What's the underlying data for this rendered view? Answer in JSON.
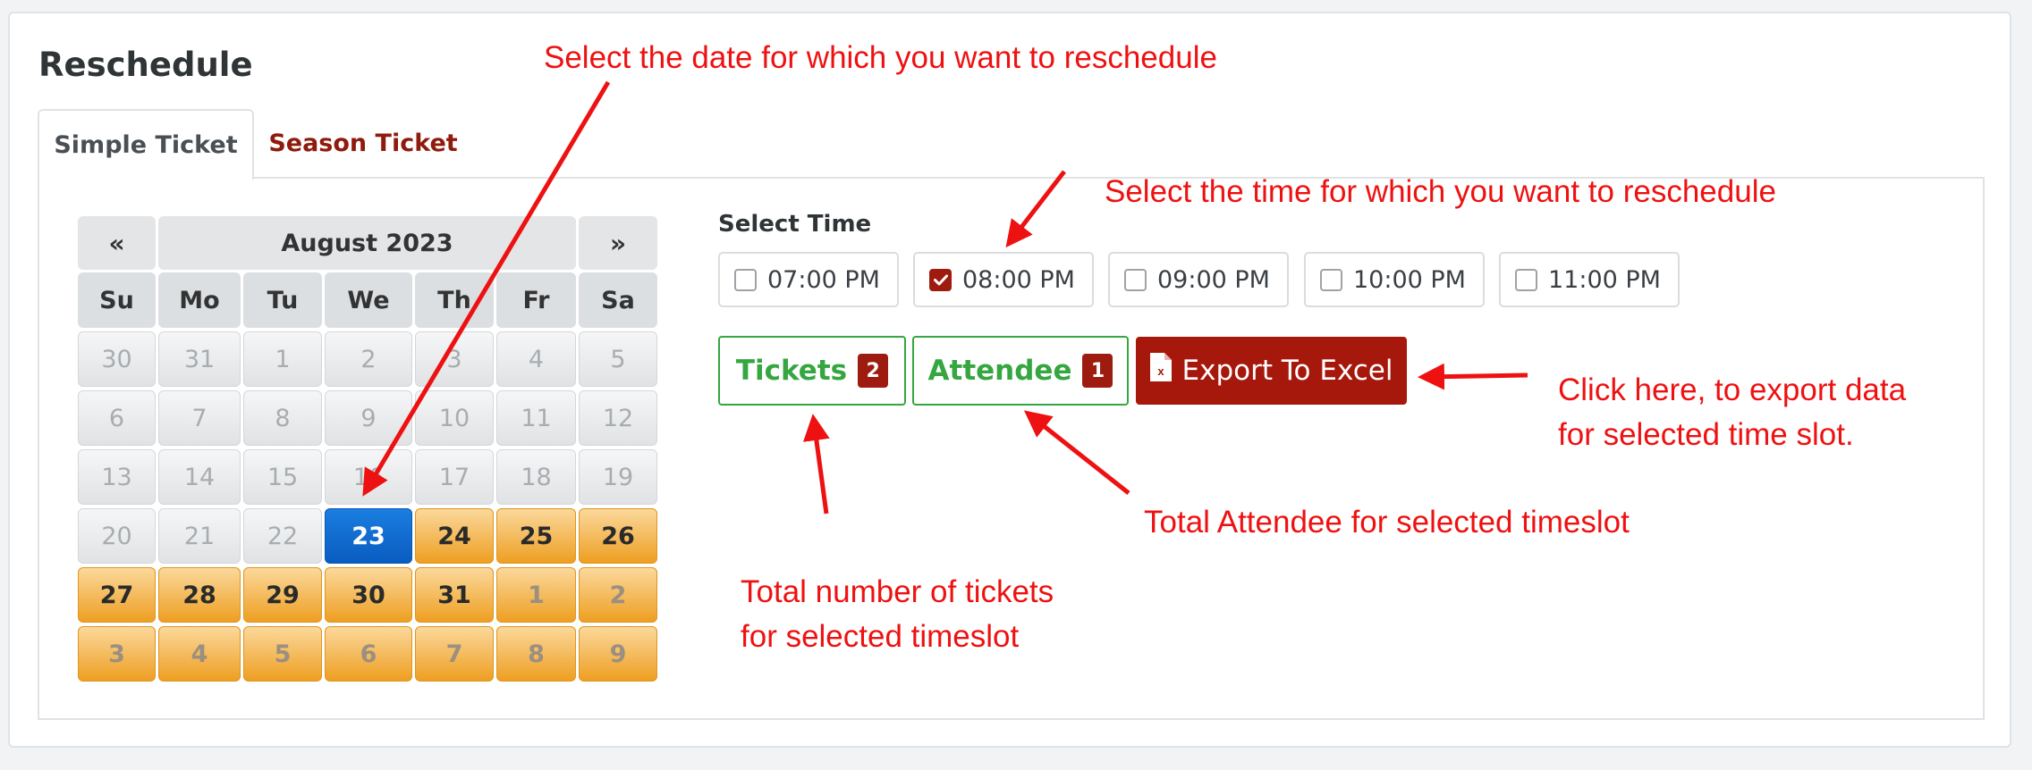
{
  "page": {
    "title": "Reschedule"
  },
  "tabs": [
    {
      "label": "Simple Ticket",
      "active": true
    },
    {
      "label": "Season Ticket",
      "active": false
    }
  ],
  "calendar": {
    "prev_label": "«",
    "next_label": "»",
    "month_label": "August 2023",
    "weekdays": [
      "Su",
      "Mo",
      "Tu",
      "We",
      "Th",
      "Fr",
      "Sa"
    ],
    "weeks": [
      [
        {
          "d": "30",
          "s": "dis"
        },
        {
          "d": "31",
          "s": "dis"
        },
        {
          "d": "1",
          "s": "dis"
        },
        {
          "d": "2",
          "s": "dis"
        },
        {
          "d": "3",
          "s": "dis"
        },
        {
          "d": "4",
          "s": "dis"
        },
        {
          "d": "5",
          "s": "dis"
        }
      ],
      [
        {
          "d": "6",
          "s": "dis"
        },
        {
          "d": "7",
          "s": "dis"
        },
        {
          "d": "8",
          "s": "dis"
        },
        {
          "d": "9",
          "s": "dis"
        },
        {
          "d": "10",
          "s": "dis"
        },
        {
          "d": "11",
          "s": "dis"
        },
        {
          "d": "12",
          "s": "dis"
        }
      ],
      [
        {
          "d": "13",
          "s": "dis"
        },
        {
          "d": "14",
          "s": "dis"
        },
        {
          "d": "15",
          "s": "dis"
        },
        {
          "d": "16",
          "s": "dis"
        },
        {
          "d": "17",
          "s": "dis"
        },
        {
          "d": "18",
          "s": "dis"
        },
        {
          "d": "19",
          "s": "dis"
        }
      ],
      [
        {
          "d": "20",
          "s": "dis"
        },
        {
          "d": "21",
          "s": "dis"
        },
        {
          "d": "22",
          "s": "dis"
        },
        {
          "d": "23",
          "s": "sel"
        },
        {
          "d": "24",
          "s": "avail"
        },
        {
          "d": "25",
          "s": "avail"
        },
        {
          "d": "26",
          "s": "avail"
        }
      ],
      [
        {
          "d": "27",
          "s": "avail"
        },
        {
          "d": "28",
          "s": "avail"
        },
        {
          "d": "29",
          "s": "avail"
        },
        {
          "d": "30",
          "s": "avail"
        },
        {
          "d": "31",
          "s": "avail"
        },
        {
          "d": "1",
          "s": "other"
        },
        {
          "d": "2",
          "s": "other"
        }
      ],
      [
        {
          "d": "3",
          "s": "other"
        },
        {
          "d": "4",
          "s": "other"
        },
        {
          "d": "5",
          "s": "other"
        },
        {
          "d": "6",
          "s": "other"
        },
        {
          "d": "7",
          "s": "other"
        },
        {
          "d": "8",
          "s": "other"
        },
        {
          "d": "9",
          "s": "other"
        }
      ]
    ]
  },
  "time_select": {
    "label": "Select Time",
    "slots": [
      {
        "time": "07:00 PM",
        "checked": false
      },
      {
        "time": "08:00 PM",
        "checked": true
      },
      {
        "time": "09:00 PM",
        "checked": false
      },
      {
        "time": "10:00 PM",
        "checked": false
      },
      {
        "time": "11:00 PM",
        "checked": false
      }
    ]
  },
  "actions": {
    "tickets": {
      "label": "Tickets",
      "count": "2"
    },
    "attendee": {
      "label": "Attendee",
      "count": "1"
    },
    "export": {
      "label": "Export To Excel"
    }
  },
  "annotations": {
    "select_date": "Select the date for which you want to reschedule",
    "select_time": "Select the time for which you want to reschedule",
    "export_line1": "Click here, to export data",
    "export_line2": "for selected time slot.",
    "attendee_total": "Total Attendee for selected timeslot",
    "tickets_line1": "Total number of tickets",
    "tickets_line2": "for selected timeslot"
  },
  "colors": {
    "accent_red": "#a6170c",
    "success_green": "#35a640",
    "annotation_red": "#ee1111",
    "selected_day_blue": "#0a5cc0",
    "available_day_orange": "#ee9f22"
  }
}
